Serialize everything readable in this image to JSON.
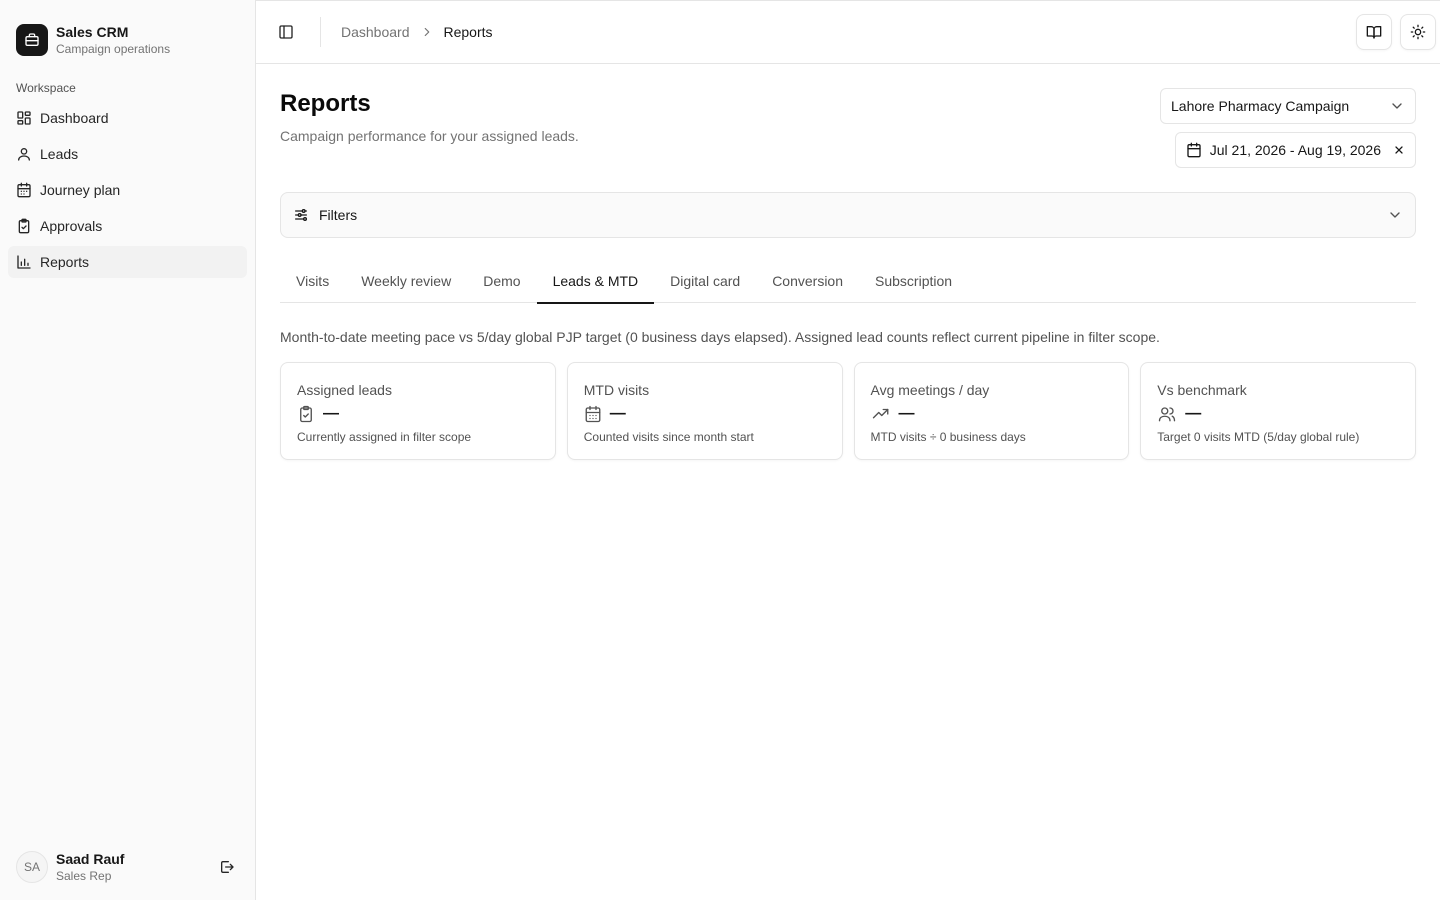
{
  "brand": {
    "name": "Sales CRM",
    "subtitle": "Campaign operations",
    "icon": "briefcase-icon"
  },
  "sidebar": {
    "group_label": "Workspace",
    "items": [
      {
        "label": "Dashboard",
        "icon": "layout-grid-icon",
        "active": false
      },
      {
        "label": "Leads",
        "icon": "user-icon",
        "active": false
      },
      {
        "label": "Journey plan",
        "icon": "calendar-icon",
        "active": false
      },
      {
        "label": "Approvals",
        "icon": "clipboard-check-icon",
        "active": false
      },
      {
        "label": "Reports",
        "icon": "bar-chart-icon",
        "active": true
      }
    ]
  },
  "user": {
    "initials": "SA",
    "name": "Saad Rauf",
    "role": "Sales Rep"
  },
  "topbar": {
    "breadcrumb": {
      "parent": "Dashboard",
      "current": "Reports"
    }
  },
  "page": {
    "title": "Reports",
    "subtitle": "Campaign performance for your assigned leads."
  },
  "controls": {
    "campaign": "Lahore Pharmacy Campaign",
    "date_range": "Jul 21, 2026 - Aug 19, 2026"
  },
  "filters": {
    "label": "Filters"
  },
  "tabs": [
    {
      "label": "Visits",
      "active": false
    },
    {
      "label": "Weekly review",
      "active": false
    },
    {
      "label": "Demo",
      "active": false
    },
    {
      "label": "Leads & MTD",
      "active": true
    },
    {
      "label": "Digital card",
      "active": false
    },
    {
      "label": "Conversion",
      "active": false
    },
    {
      "label": "Subscription",
      "active": false
    }
  ],
  "description": "Month-to-date meeting pace vs 5/day global PJP target (0 business days elapsed). Assigned lead counts reflect current pipeline in filter scope.",
  "cards": [
    {
      "title": "Assigned leads",
      "value": "—",
      "note": "Currently assigned in filter scope",
      "icon": "clipboard-check-icon"
    },
    {
      "title": "MTD visits",
      "value": "—",
      "note": "Counted visits since month start",
      "icon": "calendar-days-icon"
    },
    {
      "title": "Avg meetings / day",
      "value": "—",
      "note": "MTD visits ÷ 0 business days",
      "icon": "trending-up-icon"
    },
    {
      "title": "Vs benchmark",
      "value": "—",
      "note": "Target 0 visits MTD (5/day global rule)",
      "icon": "users-icon"
    }
  ]
}
